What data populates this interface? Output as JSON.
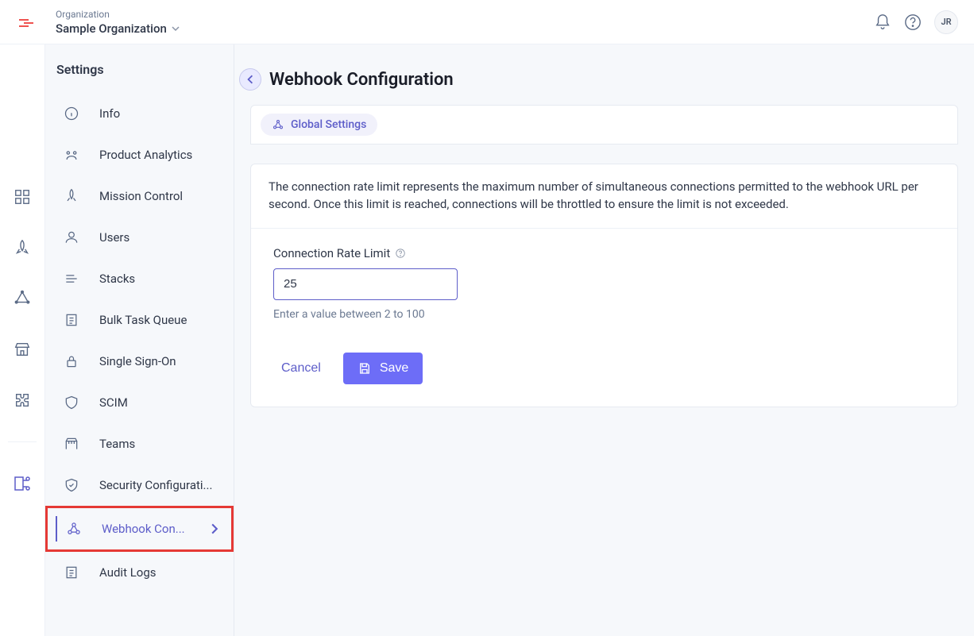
{
  "header": {
    "org_label": "Organization",
    "org_name": "Sample Organization",
    "avatar_initials": "JR"
  },
  "sidebar": {
    "title": "Settings",
    "items": [
      {
        "label": "Info",
        "icon": "info-icon"
      },
      {
        "label": "Product Analytics",
        "icon": "analytics-icon"
      },
      {
        "label": "Mission Control",
        "icon": "mission-icon"
      },
      {
        "label": "Users",
        "icon": "user-icon"
      },
      {
        "label": "Stacks",
        "icon": "stacks-icon"
      },
      {
        "label": "Bulk Task Queue",
        "icon": "queue-icon"
      },
      {
        "label": "Single Sign-On",
        "icon": "lock-icon"
      },
      {
        "label": "SCIM",
        "icon": "shield-icon"
      },
      {
        "label": "Teams",
        "icon": "teams-icon"
      },
      {
        "label": "Security Configurati...",
        "icon": "shield2-icon"
      },
      {
        "label": "Webhook Con...",
        "icon": "webhook-icon"
      },
      {
        "label": "Audit Logs",
        "icon": "logs-icon"
      }
    ]
  },
  "page": {
    "title": "Webhook Configuration",
    "tab_label": "Global Settings",
    "description": "The connection rate limit represents the maximum number of simultaneous connections permitted to the webhook URL per second. Once this limit is reached, connections will be throttled to ensure the limit is not exceeded.",
    "field_label": "Connection Rate Limit",
    "field_value": "25",
    "help_text": "Enter a value between 2 to 100",
    "cancel_label": "Cancel",
    "save_label": "Save"
  }
}
